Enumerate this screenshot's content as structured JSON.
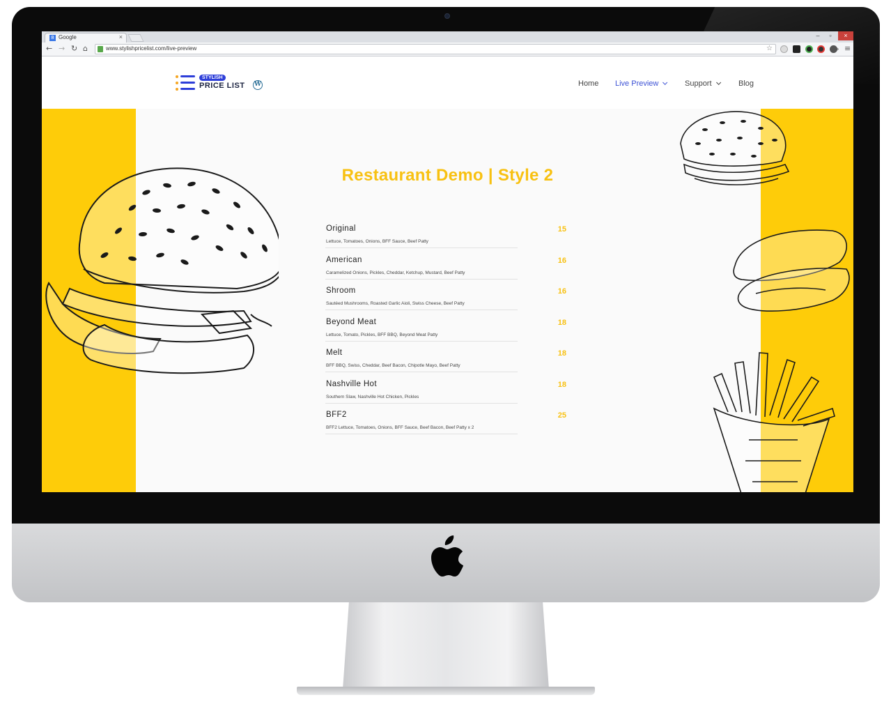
{
  "browser": {
    "tab_title": "Google",
    "tab_favicon": "8",
    "url": "www.stylishpricelist.com/live-preview",
    "window_controls": {
      "minimize": "–",
      "maximize": "▫",
      "close": "×"
    },
    "nav_icons": {
      "back": "←",
      "forward": "→",
      "reload": "↻",
      "home": "⌂",
      "bookmark": "☆",
      "menu": "≡",
      "overflow": "»"
    }
  },
  "site": {
    "logo_badge": "STYLISH",
    "logo_text": "PRICE LIST",
    "wp_icon_letter": "W",
    "nav": [
      {
        "label": "Home",
        "active": false,
        "dropdown": false
      },
      {
        "label": "Live Preview",
        "active": true,
        "dropdown": true
      },
      {
        "label": "Support",
        "active": false,
        "dropdown": true
      },
      {
        "label": "Blog",
        "active": false,
        "dropdown": false
      }
    ]
  },
  "menu": {
    "title": "Restaurant Demo | Style 2",
    "items": [
      {
        "name": "Original",
        "description": "Lettuce, Tomatoes, Onions, BFF Sauce, Beef Patty",
        "price": "15"
      },
      {
        "name": "American",
        "description": "Caramelized Onions, Pickles, Cheddar, Ketchup, Mustard, Beef Patty",
        "price": "16"
      },
      {
        "name": "Shroom",
        "description": "Sautéed Mushrooms, Roasted Garlic Aioli, Swiss Cheese, Beef Patty",
        "price": "16"
      },
      {
        "name": "Beyond Meat",
        "description": "Lettuce, Tomato, Pickles, BFF BBQ, Beyond Meat Patty",
        "price": "18"
      },
      {
        "name": "Melt",
        "description": "BFF BBQ, Swiss, Cheddar, Beef Bacon, Chipotle Mayo, Beef Patty",
        "price": "18"
      },
      {
        "name": "Nashville Hot",
        "description": "Southern Slaw, Nashville Hot Chicken, Pickles",
        "price": "18"
      },
      {
        "name": "BFF2",
        "description": "BFF2 Lettuce, Tomatoes, Onions, BFF Sauce, Beef Bacon, Beef Patty x 2",
        "price": "25"
      }
    ]
  },
  "colors": {
    "accent_yellow": "#fecc09",
    "title_yellow": "#f8c112",
    "brand_blue": "#2d3ed9",
    "nav_active": "#3d52d5"
  },
  "icons": [
    "apple-logo-icon",
    "wordpress-icon",
    "lock-icon",
    "star-icon",
    "burger-illustration-icon",
    "fries-illustration-icon"
  ]
}
